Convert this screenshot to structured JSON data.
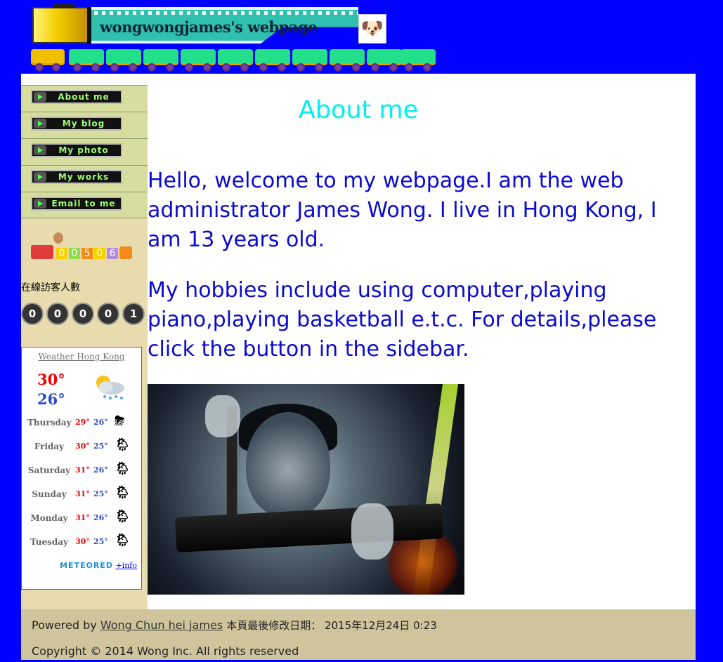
{
  "header": {
    "title": "wongwongjames's webpage"
  },
  "sidebar": {
    "menu": [
      {
        "label": "About me"
      },
      {
        "label": "My blog"
      },
      {
        "label": "My photo"
      },
      {
        "label": "My works"
      },
      {
        "label": "Email to me"
      }
    ],
    "counter_digits": [
      "0",
      "0",
      "5",
      "0",
      "6"
    ],
    "online_label": "在線訪客人數",
    "online_digits": [
      "0",
      "0",
      "0",
      "0",
      "1"
    ]
  },
  "weather": {
    "title": "Weather Hong Kong",
    "now_high": "30°",
    "now_low": "26°",
    "forecast": [
      {
        "day": "Thursday",
        "high": "29°",
        "low": "26°",
        "icon": "thunderstorm-icon"
      },
      {
        "day": "Friday",
        "high": "30°",
        "low": "25°",
        "icon": "sun-rain-icon"
      },
      {
        "day": "Saturday",
        "high": "31°",
        "low": "26°",
        "icon": "sun-rain-icon"
      },
      {
        "day": "Sunday",
        "high": "31°",
        "low": "25°",
        "icon": "sun-rain-icon"
      },
      {
        "day": "Monday",
        "high": "31°",
        "low": "26°",
        "icon": "sun-rain-icon"
      },
      {
        "day": "Tuesday",
        "high": "30°",
        "low": "25°",
        "icon": "sun-rain-icon"
      }
    ],
    "brand": "METEORED",
    "info_link": "+info"
  },
  "main": {
    "heading": "About me",
    "paragraph1": "Hello, welcome to my webpage.I am the web administrator James Wong. I live in Hong Kong, I am 13 years old.",
    "paragraph2": "My hobbies include using computer,playing piano,playing basketball e.t.c. For details,please click the button in the sidebar."
  },
  "footer": {
    "powered_prefix": "Powered by",
    "author_link": "Wong Chun hei james",
    "modified": "本頁最後修改日期： 2015年12月24日 0:23",
    "copyright": "Copyright © 2014 Wong Inc. All rights reserved"
  },
  "colors": {
    "background": "#0000ff",
    "heading": "#00f0f0",
    "body_text": "#0a0ad0",
    "sidebar": "#e8dcae",
    "footer": "#cfc59c"
  }
}
